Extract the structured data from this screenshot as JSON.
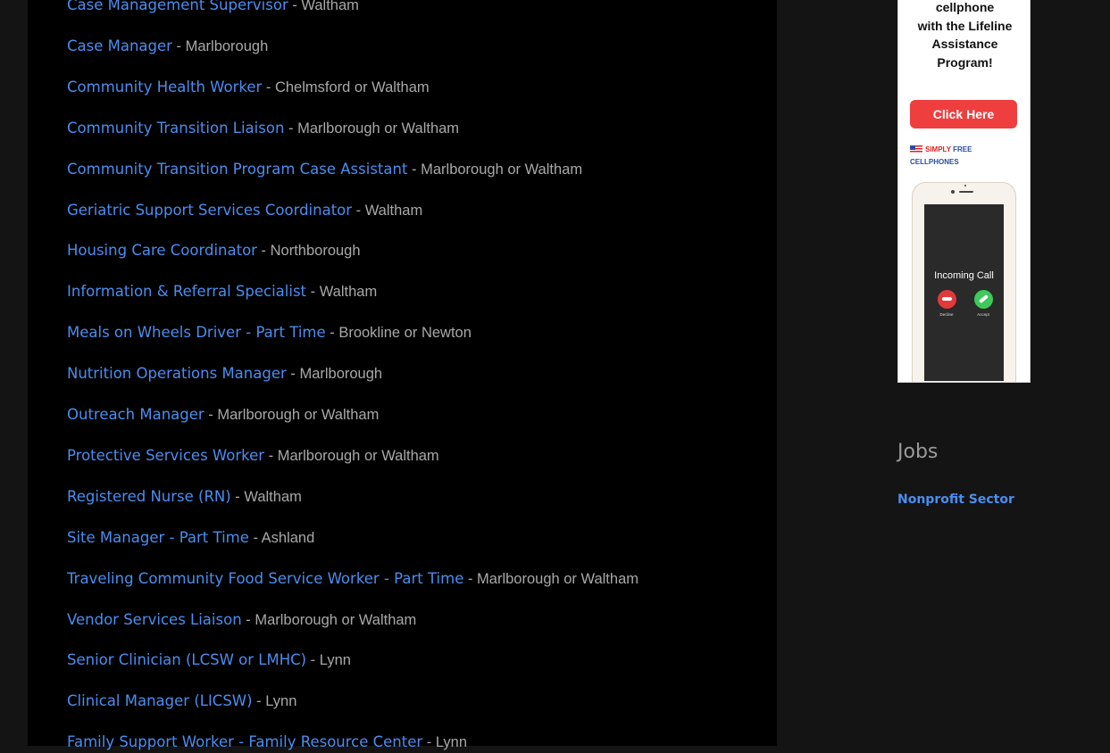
{
  "jobs": [
    {
      "title": "Case Management Supervisor",
      "location": "Waltham"
    },
    {
      "title": "Case Manager",
      "location": "Marlborough"
    },
    {
      "title": "Community Health Worker",
      "location": "Chelmsford or Waltham"
    },
    {
      "title": "Community Transition Liaison",
      "location": "Marlborough or Waltham"
    },
    {
      "title": "Community Transition Program Case Assistant",
      "location": "Marlborough or Waltham"
    },
    {
      "title": "Geriatric Support Services Coordinator",
      "location": "Waltham"
    },
    {
      "title": "Housing Care Coordinator",
      "location": "Northborough"
    },
    {
      "title": "Information & Referral Specialist",
      "location": "Waltham"
    },
    {
      "title": "Meals on Wheels Driver - Part Time",
      "location": "Brookline or Newton"
    },
    {
      "title": "Nutrition Operations Manager",
      "location": "Marlborough"
    },
    {
      "title": "Outreach Manager",
      "location": "Marlborough or Waltham"
    },
    {
      "title": "Protective Services Worker",
      "location": "Marlborough or Waltham"
    },
    {
      "title": "Registered Nurse (RN)",
      "location": "Waltham"
    },
    {
      "title": "Site Manager - Part Time",
      "location": "Ashland"
    },
    {
      "title": "Traveling Community Food Service Worker - Part Time",
      "location": "Marlborough or Waltham"
    },
    {
      "title": "Vendor Services Liaison",
      "location": "Marlborough or Waltham"
    },
    {
      "title": "Senior Clinician (LCSW or LMHC)",
      "location": "Lynn"
    },
    {
      "title": "Clinical Manager (LICSW)",
      "location": "Lynn"
    },
    {
      "title": "Family Support Worker - Family Resource Center",
      "location": "Lynn"
    }
  ],
  "separator": " - ",
  "ad": {
    "line1": "cellphone",
    "line2": "with the Lifeline",
    "line3": "Assistance",
    "line4": "Program!",
    "button": "Click Here",
    "brand_part1": "SIMPLY",
    "brand_part2": "FREE CELLPHONES",
    "call_text": "Incoming Call",
    "decline_label": "Decline",
    "accept_label": "Accept"
  },
  "sidebar": {
    "jobs_heading": "Jobs",
    "nonprofit_link": "Nonprofit Sector"
  },
  "colors": {
    "link": "#4a8ef0",
    "location_text": "#a8a8a8",
    "panel_bg": "#000000",
    "page_bg": "#141414"
  }
}
